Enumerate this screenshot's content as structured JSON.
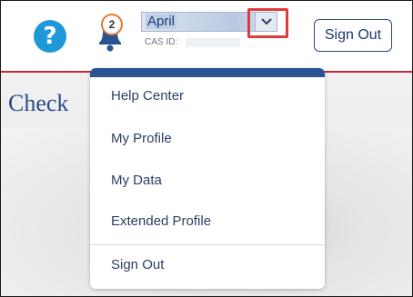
{
  "header": {
    "help_icon_glyph": "?",
    "notification_count": "2",
    "user": {
      "name": "April",
      "cas_label": "CAS ID:"
    },
    "sign_out_label": "Sign Out"
  },
  "page": {
    "title": "Check"
  },
  "dropdown": {
    "items": [
      {
        "label": "Help Center"
      },
      {
        "label": "My Profile"
      },
      {
        "label": "My Data"
      },
      {
        "label": "Extended Profile"
      },
      {
        "label": "Sign Out"
      }
    ]
  },
  "colors": {
    "accent_red": "#c8293b",
    "primary_blue": "#2a5391",
    "help_blue": "#1e98d8",
    "badge_orange": "#e07a33",
    "highlight_red": "#e0393b"
  }
}
